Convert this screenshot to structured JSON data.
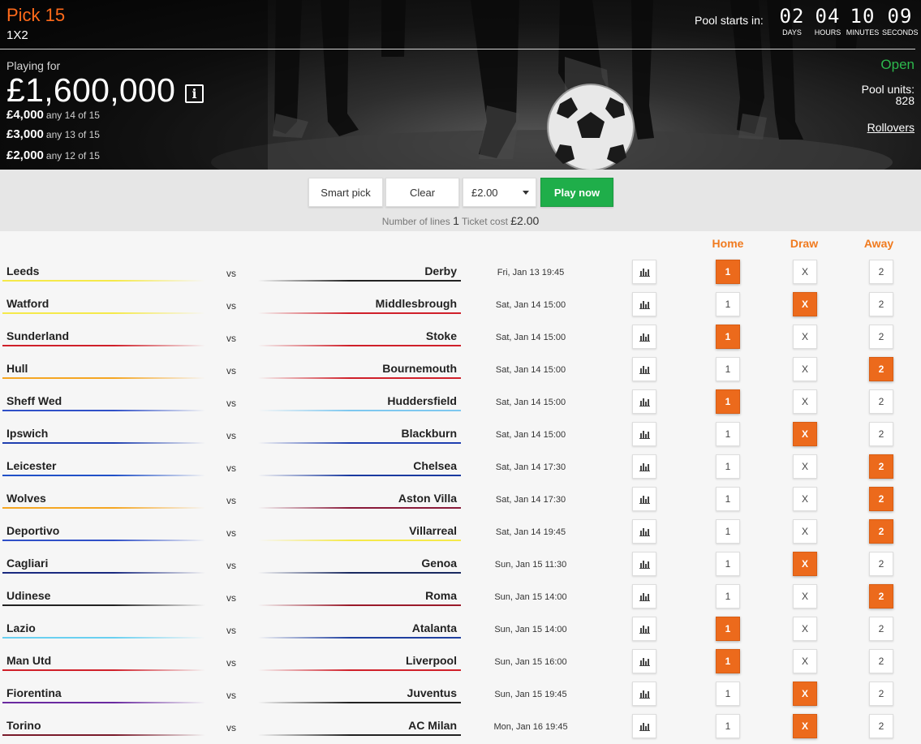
{
  "header": {
    "title": "Pick 15",
    "subtitle": "1X2",
    "playing_for_label": "Playing for",
    "jackpot": "£1,600,000",
    "info_glyph": "i",
    "prizes": [
      {
        "amount": "£4,000",
        "condition": "any 14 of 15"
      },
      {
        "amount": "£3,000",
        "condition": "any 13 of 15"
      },
      {
        "amount": "£2,000",
        "condition": "any 12 of 15"
      }
    ],
    "pool_starts_label": "Pool starts in:",
    "countdown": [
      {
        "value": "02",
        "label": "DAYS"
      },
      {
        "value": "04",
        "label": "HOURS"
      },
      {
        "value": "10",
        "label": "MINUTES"
      },
      {
        "value": "09",
        "label": "SECONDS"
      }
    ],
    "status": "Open",
    "pool_units_label": "Pool units:",
    "pool_units_value": "828",
    "rollovers_label": "Rollovers"
  },
  "toolbar": {
    "smart_pick_label": "Smart pick",
    "clear_label": "Clear",
    "stake_value": "£2.00",
    "play_label": "Play now",
    "lines_label": "Number of lines",
    "lines_value": "1",
    "cost_label": "Ticket cost",
    "cost_value": "£2.00"
  },
  "table": {
    "headers": {
      "home": "Home",
      "draw": "Draw",
      "away": "Away"
    },
    "vs_label": "vs",
    "pick_labels": {
      "home": "1",
      "draw": "X",
      "away": "2"
    },
    "matches": [
      {
        "home": "Leeds",
        "away": "Derby",
        "date": "Fri, Jan 13 19:45",
        "selection": "home",
        "home_color": "#f5e94a",
        "away_color": "#222222"
      },
      {
        "home": "Watford",
        "away": "Middlesbrough",
        "date": "Sat, Jan 14 15:00",
        "selection": "draw",
        "home_color": "#f5e94a",
        "away_color": "#d0202a"
      },
      {
        "home": "Sunderland",
        "away": "Stoke",
        "date": "Sat, Jan 14 15:00",
        "selection": "home",
        "home_color": "#d0202a",
        "away_color": "#d0202a"
      },
      {
        "home": "Hull",
        "away": "Bournemouth",
        "date": "Sat, Jan 14 15:00",
        "selection": "away",
        "home_color": "#f5a623",
        "away_color": "#d0202a"
      },
      {
        "home": "Sheff Wed",
        "away": "Huddersfield",
        "date": "Sat, Jan 14 15:00",
        "selection": "home",
        "home_color": "#3050c8",
        "away_color": "#7ec8f0"
      },
      {
        "home": "Ipswich",
        "away": "Blackburn",
        "date": "Sat, Jan 14 15:00",
        "selection": "draw",
        "home_color": "#2040b0",
        "away_color": "#2040b0"
      },
      {
        "home": "Leicester",
        "away": "Chelsea",
        "date": "Sat, Jan 14 17:30",
        "selection": "away",
        "home_color": "#2050c8",
        "away_color": "#1a3aa0"
      },
      {
        "home": "Wolves",
        "away": "Aston Villa",
        "date": "Sat, Jan 14 17:30",
        "selection": "away",
        "home_color": "#f5a623",
        "away_color": "#8a1a3a"
      },
      {
        "home": "Deportivo",
        "away": "Villarreal",
        "date": "Sat, Jan 14 19:45",
        "selection": "away",
        "home_color": "#3050c8",
        "away_color": "#f5e94a"
      },
      {
        "home": "Cagliari",
        "away": "Genoa",
        "date": "Sun, Jan 15 11:30",
        "selection": "draw",
        "home_color": "#1a2a80",
        "away_color": "#1a2a60"
      },
      {
        "home": "Udinese",
        "away": "Roma",
        "date": "Sun, Jan 15 14:00",
        "selection": "away",
        "home_color": "#222222",
        "away_color": "#9a1a2a"
      },
      {
        "home": "Lazio",
        "away": "Atalanta",
        "date": "Sun, Jan 15 14:00",
        "selection": "home",
        "home_color": "#6ad0f0",
        "away_color": "#2040a0"
      },
      {
        "home": "Man Utd",
        "away": "Liverpool",
        "date": "Sun, Jan 15 16:00",
        "selection": "home",
        "home_color": "#d0202a",
        "away_color": "#d0202a"
      },
      {
        "home": "Fiorentina",
        "away": "Juventus",
        "date": "Sun, Jan 15 19:45",
        "selection": "draw",
        "home_color": "#6a2aa0",
        "away_color": "#222222"
      },
      {
        "home": "Torino",
        "away": "AC Milan",
        "date": "Mon, Jan 16 19:45",
        "selection": "draw",
        "home_color": "#7a1a2a",
        "away_color": "#222222"
      }
    ]
  }
}
